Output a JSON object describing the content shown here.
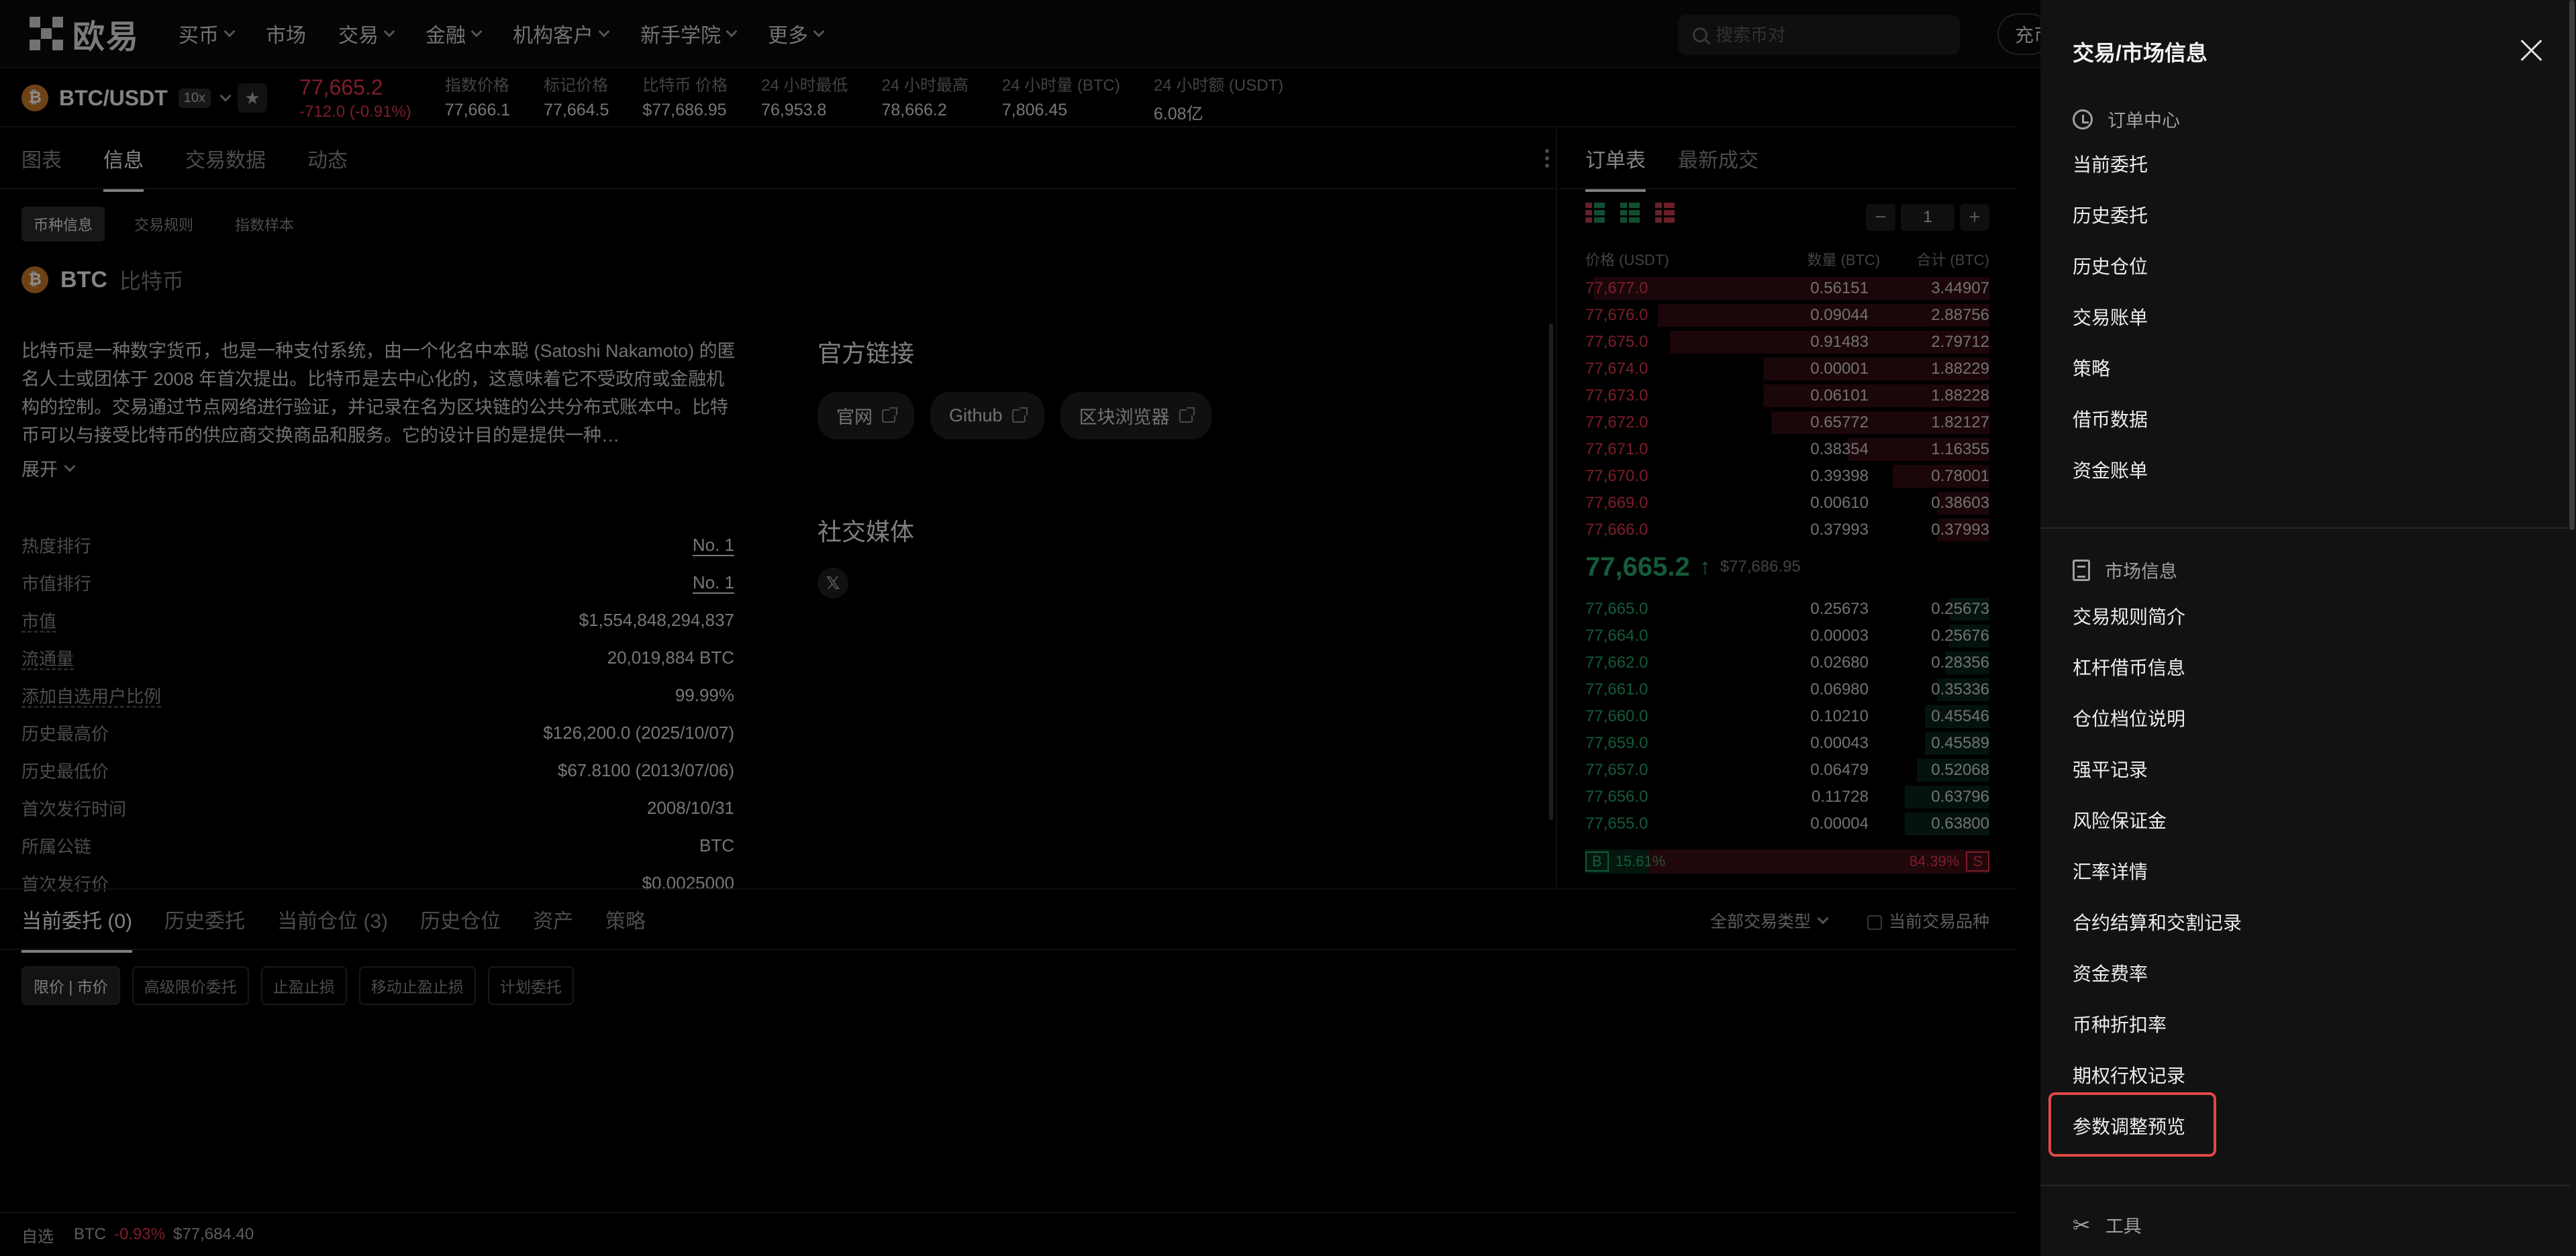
{
  "nav": {
    "logo": "欧易",
    "items": [
      "买币",
      "市场",
      "交易",
      "金融",
      "机构客户",
      "新手学院",
      "更多"
    ],
    "search_placeholder": "搜索币对",
    "deposit": "充币"
  },
  "ticker": {
    "pair": "BTC/USDT",
    "leverage": "10x",
    "coin_glyph": "₿",
    "last_price": "77,665.2",
    "change": "-712.0 (-0.91%)",
    "stats": [
      {
        "label": "指数价格",
        "value": "77,666.1"
      },
      {
        "label": "标记价格",
        "value": "77,664.5"
      },
      {
        "label": "比特币 价格",
        "value": "$77,686.95"
      },
      {
        "label": "24 小时最低",
        "value": "76,953.8"
      },
      {
        "label": "24 小时最高",
        "value": "78,666.2"
      },
      {
        "label": "24 小时量 (BTC)",
        "value": "7,806.45"
      },
      {
        "label": "24 小时额 (USDT)",
        "value": "6.08亿"
      }
    ]
  },
  "main": {
    "tabs": [
      "图表",
      "信息",
      "交易数据",
      "动态"
    ],
    "subtabs": [
      "币种信息",
      "交易规则",
      "指数样本"
    ],
    "coin_symbol": "BTC",
    "coin_name": "比特币",
    "description": "比特币是一种数字货币，也是一种支付系统，由一个化名中本聪 (Satoshi Nakamoto) 的匿名人士或团体于 2008 年首次提出。比特币是去中心化的，这意味着它不受政府或金融机构的控制。交易通过节点网络进行验证，并记录在名为区块链的公共分布式账本中。比特币可以与接受比特币的供应商交换商品和服务。它的设计目的是提供一种…",
    "expand": "展开",
    "info_rows": [
      {
        "k": "热度排行",
        "v": "No. 1"
      },
      {
        "k": "市值排行",
        "v": "No. 1"
      },
      {
        "k": "市值",
        "v": "$1,554,848,294,837"
      },
      {
        "k": "流通量",
        "v": "20,019,884 BTC"
      },
      {
        "k": "添加自选用户比例",
        "v": "99.99%"
      },
      {
        "k": "历史最高价",
        "v": "$126,200.0 (2025/10/07)"
      },
      {
        "k": "历史最低价",
        "v": "$67.8100 (2013/07/06)"
      },
      {
        "k": "首次发行时间",
        "v": "2008/10/31"
      },
      {
        "k": "所属公链",
        "v": "BTC"
      },
      {
        "k": "首次发行价",
        "v": "$0.0025000"
      }
    ],
    "official_links_title": "官方链接",
    "links": [
      "官网",
      "Github",
      "区块浏览器"
    ],
    "social_title": "社交媒体",
    "x_glyph": "𝕏"
  },
  "orderbook": {
    "tabs": [
      "订单表",
      "最新成交"
    ],
    "step_value": "1",
    "headers": [
      "价格 (USDT)",
      "数量 (BTC)",
      "合计 (BTC)"
    ],
    "asks": [
      {
        "price": "77,677.0",
        "qty": "0.56151",
        "total": "3.44907",
        "depth": 0.98
      },
      {
        "price": "77,676.0",
        "qty": "0.09044",
        "total": "2.88756",
        "depth": 0.82
      },
      {
        "price": "77,675.0",
        "qty": "0.91483",
        "total": "2.79712",
        "depth": 0.79
      },
      {
        "price": "77,674.0",
        "qty": "0.00001",
        "total": "1.88229",
        "depth": 0.56
      },
      {
        "price": "77,673.0",
        "qty": "0.06101",
        "total": "1.88228",
        "depth": 0.56
      },
      {
        "price": "77,672.0",
        "qty": "0.65772",
        "total": "1.82127",
        "depth": 0.54
      },
      {
        "price": "77,671.0",
        "qty": "0.38354",
        "total": "1.16355",
        "depth": 0.35
      },
      {
        "price": "77,670.0",
        "qty": "0.39398",
        "total": "0.78001",
        "depth": 0.24
      },
      {
        "price": "77,669.0",
        "qty": "0.00610",
        "total": "0.38603",
        "depth": 0.13
      },
      {
        "price": "77,666.0",
        "qty": "0.37993",
        "total": "0.37993",
        "depth": 0.13
      }
    ],
    "mid_price": "77,665.2",
    "mid_arrow": "↑",
    "mid_usd": "$77,686.95",
    "bids": [
      {
        "price": "77,665.0",
        "qty": "0.25673",
        "total": "0.25673",
        "depth": 0.1
      },
      {
        "price": "77,664.0",
        "qty": "0.00003",
        "total": "0.25676",
        "depth": 0.1
      },
      {
        "price": "77,662.0",
        "qty": "0.02680",
        "total": "0.28356",
        "depth": 0.11
      },
      {
        "price": "77,661.0",
        "qty": "0.06980",
        "total": "0.35336",
        "depth": 0.13
      },
      {
        "price": "77,660.0",
        "qty": "0.10210",
        "total": "0.45546",
        "depth": 0.16
      },
      {
        "price": "77,659.0",
        "qty": "0.00043",
        "total": "0.45589",
        "depth": 0.16
      },
      {
        "price": "77,657.0",
        "qty": "0.06479",
        "total": "0.52068",
        "depth": 0.18
      },
      {
        "price": "77,656.0",
        "qty": "0.11728",
        "total": "0.63796",
        "depth": 0.21
      },
      {
        "price": "77,655.0",
        "qty": "0.00004",
        "total": "0.63800",
        "depth": 0.21
      }
    ],
    "buy_tag": "B",
    "buy_pct": "15.61%",
    "sell_pct": "84.39%",
    "sell_tag": "S",
    "buy_fraction": 0.1561
  },
  "bottom": {
    "tabs": [
      "当前委托 (0)",
      "历史委托",
      "当前仓位 (3)",
      "历史仓位",
      "资产",
      "策略"
    ],
    "trade_type": "全部交易类型",
    "current_only": "当前交易品种",
    "filters": [
      "限价 | 市价",
      "高级限价委托",
      "止盈止损",
      "移动止盈止损",
      "计划委托"
    ]
  },
  "footer": {
    "watchlist": "自选",
    "symbol": "BTC",
    "change": "-0.93%",
    "price": "$77,684.40"
  },
  "drawer": {
    "title": "交易/市场信息",
    "order_center": "订单中心",
    "order_items": [
      "当前委托",
      "历史委托",
      "历史仓位",
      "交易账单",
      "策略",
      "借币数据",
      "资金账单"
    ],
    "market_info": "市场信息",
    "market_items": [
      "交易规则简介",
      "杠杆借币信息",
      "仓位档位说明",
      "强平记录",
      "风险保证金",
      "汇率详情",
      "合约结算和交割记录",
      "资金费率",
      "币种折扣率",
      "期权行权记录",
      "参数调整预览"
    ],
    "tools": "工具",
    "highlight_color": "#e04848"
  }
}
